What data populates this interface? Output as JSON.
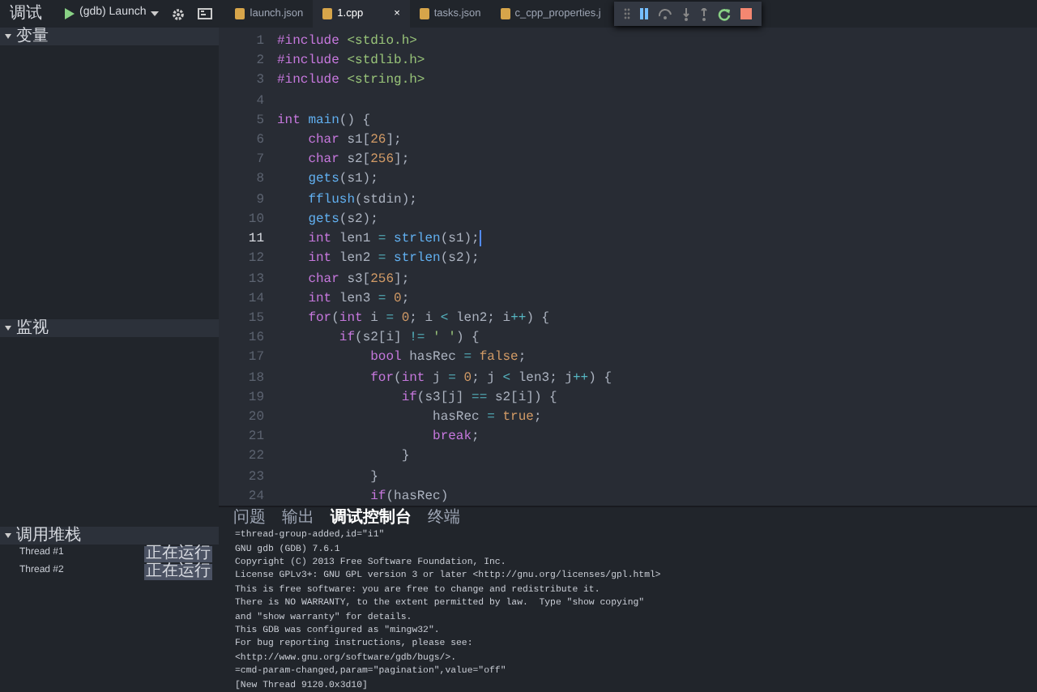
{
  "toolbar": {
    "title": "调试",
    "config": "(gdb) Launch"
  },
  "tabs": [
    {
      "label": "launch.json",
      "selected": false
    },
    {
      "label": "1.cpp",
      "selected": true,
      "close": "×"
    },
    {
      "label": "tasks.json",
      "selected": false
    },
    {
      "label": "c_cpp_properties.j",
      "selected": false
    }
  ],
  "sidebar": {
    "sections": [
      {
        "title": "变量",
        "expanded": true
      },
      {
        "title": "监视",
        "expanded": true
      },
      {
        "title": "调用堆栈",
        "expanded": true,
        "items": [
          {
            "name": "Thread #1",
            "status": "正在运行"
          },
          {
            "name": "Thread #2",
            "status": "正在运行"
          }
        ]
      }
    ]
  },
  "editor": {
    "lines": [
      {
        "number": "1",
        "current": false,
        "tokens": [
          {
            "kind": "pp",
            "text": "#include "
          },
          {
            "kind": "str",
            "text": "<stdio.h>"
          }
        ]
      },
      {
        "number": "2",
        "current": false,
        "tokens": [
          {
            "kind": "pp",
            "text": "#include "
          },
          {
            "kind": "str",
            "text": "<stdlib.h>"
          }
        ]
      },
      {
        "number": "3",
        "current": false,
        "tokens": [
          {
            "kind": "pp",
            "text": "#include "
          },
          {
            "kind": "str",
            "text": "<string.h>"
          }
        ]
      },
      {
        "number": "4",
        "current": false
      },
      {
        "number": "5",
        "current": false,
        "tokens": [
          {
            "kind": "kw",
            "text": "int "
          },
          {
            "kind": "fn",
            "text": "main"
          },
          {
            "kind": "p",
            "text": "() {"
          }
        ]
      },
      {
        "number": "6",
        "current": false,
        "tokens": [
          {
            "kind": "kw",
            "text": "    char"
          },
          {
            "kind": "p",
            "text": " s1["
          },
          {
            "kind": "num",
            "text": "26"
          },
          {
            "kind": "p",
            "text": "];"
          }
        ]
      },
      {
        "number": "7",
        "current": false,
        "tokens": [
          {
            "kind": "kw",
            "text": "    char"
          },
          {
            "kind": "p",
            "text": " s2["
          },
          {
            "kind": "num",
            "text": "256"
          },
          {
            "kind": "p",
            "text": "];"
          }
        ]
      },
      {
        "number": "8",
        "current": false,
        "tokens": [
          {
            "kind": "fn",
            "text": "    gets"
          },
          {
            "kind": "p",
            "text": "(s1);"
          }
        ]
      },
      {
        "number": "9",
        "current": false,
        "tokens": [
          {
            "kind": "fn",
            "text": "    fflush"
          },
          {
            "kind": "p",
            "text": "(stdin);"
          }
        ]
      },
      {
        "number": "10",
        "current": false,
        "tokens": [
          {
            "kind": "fn",
            "text": "    gets"
          },
          {
            "kind": "p",
            "text": "(s2);"
          }
        ]
      },
      {
        "number": "11",
        "current": true,
        "tokens": [
          {
            "kind": "kw",
            "text": "    int"
          },
          {
            "kind": "p",
            "text": " len1 "
          },
          {
            "kind": "op",
            "text": "= "
          },
          {
            "kind": "fn",
            "text": "strlen"
          },
          {
            "kind": "p",
            "text": "(s1);"
          }
        ]
      },
      {
        "number": "12",
        "current": false,
        "tokens": [
          {
            "kind": "kw",
            "text": "    int"
          },
          {
            "kind": "p",
            "text": " len2 "
          },
          {
            "kind": "op",
            "text": "= "
          },
          {
            "kind": "fn",
            "text": "strlen"
          },
          {
            "kind": "p",
            "text": "(s2);"
          }
        ]
      },
      {
        "number": "13",
        "current": false,
        "tokens": [
          {
            "kind": "kw",
            "text": "    char"
          },
          {
            "kind": "p",
            "text": " s3["
          },
          {
            "kind": "num",
            "text": "256"
          },
          {
            "kind": "p",
            "text": "];"
          }
        ]
      },
      {
        "number": "14",
        "current": false,
        "tokens": [
          {
            "kind": "kw",
            "text": "    int"
          },
          {
            "kind": "p",
            "text": " len3 "
          },
          {
            "kind": "op",
            "text": "= "
          },
          {
            "kind": "num",
            "text": "0"
          },
          {
            "kind": "p",
            "text": ";"
          }
        ]
      },
      {
        "number": "15",
        "current": false,
        "tokens": [
          {
            "kind": "kw",
            "text": "    for"
          },
          {
            "kind": "p",
            "text": "("
          },
          {
            "kind": "kw",
            "text": "int"
          },
          {
            "kind": "p",
            "text": " i "
          },
          {
            "kind": "op",
            "text": "= "
          },
          {
            "kind": "num",
            "text": "0"
          },
          {
            "kind": "p",
            "text": "; i "
          },
          {
            "kind": "op",
            "text": "<"
          },
          {
            "kind": "p",
            "text": " len2; i"
          },
          {
            "kind": "op",
            "text": "++"
          },
          {
            "kind": "p",
            "text": ") {"
          }
        ]
      },
      {
        "number": "16",
        "current": false,
        "tokens": [
          {
            "kind": "kw",
            "text": "        if"
          },
          {
            "kind": "p",
            "text": "(s2[i] "
          },
          {
            "kind": "op",
            "text": "!= "
          },
          {
            "kind": "str",
            "text": "' '"
          },
          {
            "kind": "p",
            "text": ") {"
          }
        ]
      },
      {
        "number": "17",
        "current": false,
        "tokens": [
          {
            "kind": "kw",
            "text": "            bool"
          },
          {
            "kind": "p",
            "text": " hasRec "
          },
          {
            "kind": "op",
            "text": "= "
          },
          {
            "kind": "num",
            "text": "false"
          },
          {
            "kind": "p",
            "text": ";"
          }
        ]
      },
      {
        "number": "18",
        "current": false,
        "tokens": [
          {
            "kind": "kw",
            "text": "            for"
          },
          {
            "kind": "p",
            "text": "("
          },
          {
            "kind": "kw",
            "text": "int"
          },
          {
            "kind": "p",
            "text": " j "
          },
          {
            "kind": "op",
            "text": "= "
          },
          {
            "kind": "num",
            "text": "0"
          },
          {
            "kind": "p",
            "text": "; j "
          },
          {
            "kind": "op",
            "text": "<"
          },
          {
            "kind": "p",
            "text": " len3; j"
          },
          {
            "kind": "op",
            "text": "++"
          },
          {
            "kind": "p",
            "text": ") {"
          }
        ]
      },
      {
        "number": "19",
        "current": false,
        "tokens": [
          {
            "kind": "kw",
            "text": "                if"
          },
          {
            "kind": "p",
            "text": "(s3[j] "
          },
          {
            "kind": "op",
            "text": "=="
          },
          {
            "kind": "p",
            "text": " s2[i]) {"
          }
        ]
      },
      {
        "number": "20",
        "current": false,
        "tokens": [
          {
            "kind": "p",
            "text": "                    hasRec "
          },
          {
            "kind": "op",
            "text": "= "
          },
          {
            "kind": "num",
            "text": "true"
          },
          {
            "kind": "p",
            "text": ";"
          }
        ]
      },
      {
        "number": "21",
        "current": false,
        "tokens": [
          {
            "kind": "kw",
            "text": "                    break"
          },
          {
            "kind": "p",
            "text": ";"
          }
        ]
      },
      {
        "number": "22",
        "current": false,
        "tokens": [
          {
            "kind": "p",
            "text": "                }"
          }
        ]
      },
      {
        "number": "23",
        "current": false,
        "tokens": [
          {
            "kind": "p",
            "text": "            }"
          }
        ]
      },
      {
        "number": "24",
        "current": false,
        "tokens": [
          {
            "kind": "kw",
            "text": "            if"
          },
          {
            "kind": "p",
            "text": "(hasRec)"
          }
        ]
      }
    ]
  },
  "panel": {
    "tabs": [
      {
        "label": "问题",
        "selected": false
      },
      {
        "label": "输出",
        "selected": false
      },
      {
        "label": "调试控制台",
        "selected": true
      },
      {
        "label": "终端",
        "selected": false
      }
    ],
    "console": [
      "=thread-group-added,id=\"i1\"",
      "GNU gdb (GDB) 7.6.1",
      "Copyright (C) 2013 Free Software Foundation, Inc.",
      "License GPLv3+: GNU GPL version 3 or later <http://gnu.org/licenses/gpl.html>",
      "This is free software: you are free to change and redistribute it.",
      "There is NO WARRANTY, to the extent permitted by law.  Type \"show copying\"",
      "and \"show warranty\" for details.",
      "This GDB was configured as \"mingw32\".",
      "For bug reporting instructions, please see:",
      "<http://www.gnu.org/software/gdb/bugs/>.",
      "=cmd-param-changed,param=\"pagination\",value=\"off\"",
      "[New Thread 9120.0x3d10]"
    ]
  }
}
